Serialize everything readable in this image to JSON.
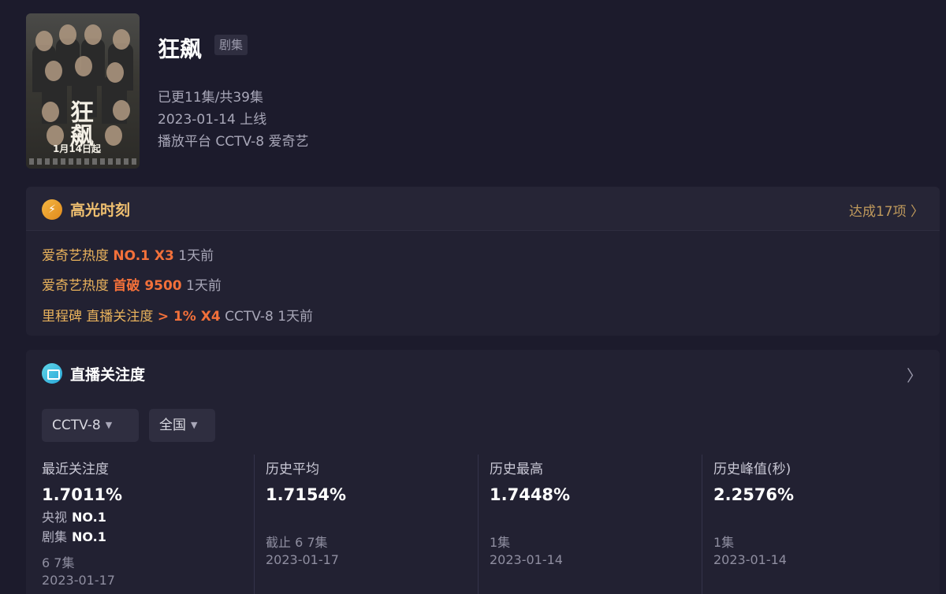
{
  "show": {
    "title": "狂飙",
    "tag": "剧集",
    "episodes": "已更11集/共39集",
    "release": "2023-01-14 上线",
    "platform": "播放平台 CCTV-8 爱奇艺",
    "poster": {
      "title_text": "狂飙",
      "date_text": "1月14日起"
    }
  },
  "highlights": {
    "title": "高光时刻",
    "more": "达成17项 〉",
    "rows": [
      {
        "label": "爱奇艺热度",
        "value": "NO.1 X3",
        "ago": "1天前"
      },
      {
        "label": "爱奇艺热度",
        "value": "首破 9500",
        "ago": "1天前"
      },
      {
        "label": "里程碑 直播关注度",
        "value": "> 1% X4",
        "ago": "CCTV-8 1天前"
      }
    ]
  },
  "live": {
    "title": "直播关注度",
    "chevron": "〉",
    "dropdowns": [
      {
        "value": "CCTV-8"
      },
      {
        "value": "全国"
      }
    ],
    "stats": [
      {
        "label": "最近关注度",
        "value": "1.7011%",
        "rank1_label": "央视",
        "rank1_value": "NO.1",
        "rank2_label": "剧集",
        "rank2_value": "NO.1",
        "sub1": "6 7集",
        "sub2": "2023-01-17"
      },
      {
        "label": "历史平均",
        "value": "1.7154%",
        "sub1": "截止 6 7集",
        "sub2": "2023-01-17"
      },
      {
        "label": "历史最高",
        "value": "1.7448%",
        "sub1": "1集",
        "sub2": "2023-01-14"
      },
      {
        "label": "历史峰值(秒)",
        "value": "2.2576%",
        "sub1": "1集",
        "sub2": "2023-01-14"
      }
    ]
  },
  "colors": {
    "background": "#1c1b2c",
    "panel": "#222132",
    "highlight_label": "#e9b25c",
    "highlight_value": "#f2703a",
    "accent_gold": "#f0c070"
  },
  "icons": {
    "highlights": "lightning-bolt-icon",
    "live": "tv-chart-icon",
    "chevron": "chevron-right-icon",
    "caret": "caret-down-icon"
  }
}
